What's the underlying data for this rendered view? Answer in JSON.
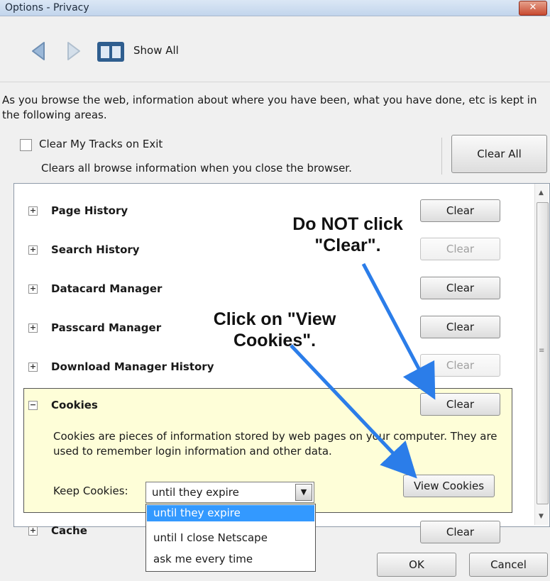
{
  "window": {
    "title": "Options - Privacy",
    "close_icon": "close-icon"
  },
  "toolbar": {
    "back_icon": "back-arrow-icon",
    "forward_icon": "forward-arrow-icon",
    "show_all_icon": "show-all-icon",
    "show_all_label": "Show All"
  },
  "intro": {
    "text": "As you browse the web, information about where you have been, what you have done, etc is kept in the following areas."
  },
  "clear_tracks": {
    "label": "Clear My Tracks on Exit",
    "description": "Clears all browse information when you close the browser.",
    "checked": false
  },
  "clear_all_label": "Clear All",
  "sections": [
    {
      "label": "Page History",
      "button": "Clear",
      "enabled": true
    },
    {
      "label": "Search History",
      "button": "Clear",
      "enabled": false
    },
    {
      "label": "Datacard Manager",
      "button": "Clear",
      "enabled": true
    },
    {
      "label": "Passcard Manager",
      "button": "Clear",
      "enabled": true
    },
    {
      "label": "Download Manager History",
      "button": "Clear",
      "enabled": false
    },
    {
      "label": "Cookies",
      "button": "Clear",
      "enabled": true,
      "expanded": true
    },
    {
      "label": "Cache",
      "button": "Clear",
      "enabled": true
    }
  ],
  "cookies": {
    "description": "Cookies are pieces of information stored by web pages on your computer. They are used to remember login information and other data.",
    "keep_label": "Keep Cookies:",
    "keep_value": "until they expire",
    "view_cookies_label": "View Cookies",
    "options": [
      "until they expire",
      "until I close Netscape",
      "ask me every time"
    ]
  },
  "annotations": {
    "do_not_click": "Do NOT click \"Clear\".",
    "click_view": "Click on \"View Cookies\"."
  },
  "dialog_buttons": {
    "ok": "OK",
    "cancel": "Cancel"
  },
  "colors": {
    "accent": "#3399ff",
    "highlight_panel": "#fefed8",
    "arrow": "#2b7de9"
  }
}
